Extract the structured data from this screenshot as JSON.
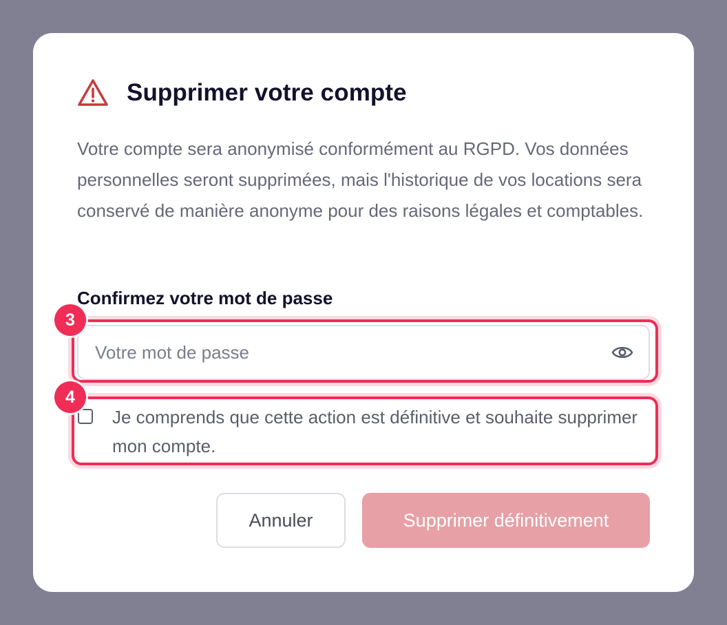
{
  "dialog": {
    "title": "Supprimer votre compte",
    "description": "Votre compte sera anonymisé conformément au RGPD. Vos données personnelles seront supprimées, mais l'historique de vos locations sera conservé de manière anonyme pour des raisons légales et comptables.",
    "icon": "warning-triangle-icon",
    "icon_color": "#c53a3f"
  },
  "password_field": {
    "label": "Confirmez votre mot de passe",
    "placeholder": "Votre mot de passe",
    "value": "",
    "toggle_icon": "eye-icon"
  },
  "confirmation": {
    "checked": false,
    "label": "Je comprends que cette action est définitive et souhaite supprimer mon compte."
  },
  "annotations": [
    {
      "number": "3",
      "target": "password-field"
    },
    {
      "number": "4",
      "target": "confirmation-checkbox"
    }
  ],
  "actions": {
    "cancel_label": "Annuler",
    "delete_label": "Supprimer définitivement",
    "delete_disabled": true
  },
  "colors": {
    "backdrop": "#817f92",
    "highlight": "#ef2d56",
    "delete_button_disabled": "#e7a0a6",
    "title": "#13112b",
    "body_text": "#656878"
  }
}
